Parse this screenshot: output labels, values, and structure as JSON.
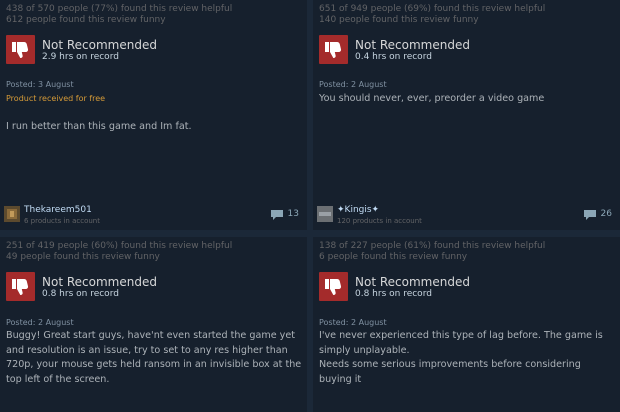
{
  "colors": {
    "background": "#1b2838",
    "card": "#16202d",
    "thumb_down_bg": "#a42b2b",
    "product_free": "#d69b38"
  },
  "reviews": [
    {
      "helpful": "438 of 570 people (77%) found this review helpful",
      "funny": "612 people found this review funny",
      "verdict": "Not Recommended",
      "hours": "2.9 hrs on record",
      "posted": "Posted: 3 August",
      "product_free": "Product received for free",
      "body": "I run better than this game and Im fat.",
      "author": "Thekareem501",
      "author_products": "6 products in account",
      "comment_count": "13",
      "icons": [
        "thumbs-down-icon",
        "comment-icon",
        "avatar-icon"
      ]
    },
    {
      "helpful": "651 of 949 people (69%) found this review helpful",
      "funny": "140 people found this review funny",
      "verdict": "Not Recommended",
      "hours": "0.4 hrs on record",
      "posted": "Posted: 2 August",
      "body": "You should never, ever, preorder a video game",
      "author": "✦Kingis✦",
      "author_products": "120 products in account",
      "comment_count": "26",
      "icons": [
        "thumbs-down-icon",
        "comment-icon",
        "avatar-icon"
      ]
    },
    {
      "helpful": "251 of 419 people (60%) found this review helpful",
      "funny": "49 people found this review funny",
      "verdict": "Not Recommended",
      "hours": "0.8 hrs on record",
      "posted": "Posted: 2 August",
      "body": "Buggy! Great start guys, have'nt even started the game yet and resolution is an issue, try to set to any res higher than 720p, your mouse gets held ransom in an invisible box at the top left of the screen.",
      "icons": [
        "thumbs-down-icon"
      ]
    },
    {
      "helpful": "138 of 227 people (61%) found this review helpful",
      "funny": "6 people found this review funny",
      "verdict": "Not Recommended",
      "hours": "0.8 hrs on record",
      "posted": "Posted: 2 August",
      "body": "I've never experienced this type of lag before. The game is simply unplayable.\nNeeds some serious improvements before considering buying it",
      "icons": [
        "thumbs-down-icon"
      ]
    }
  ]
}
